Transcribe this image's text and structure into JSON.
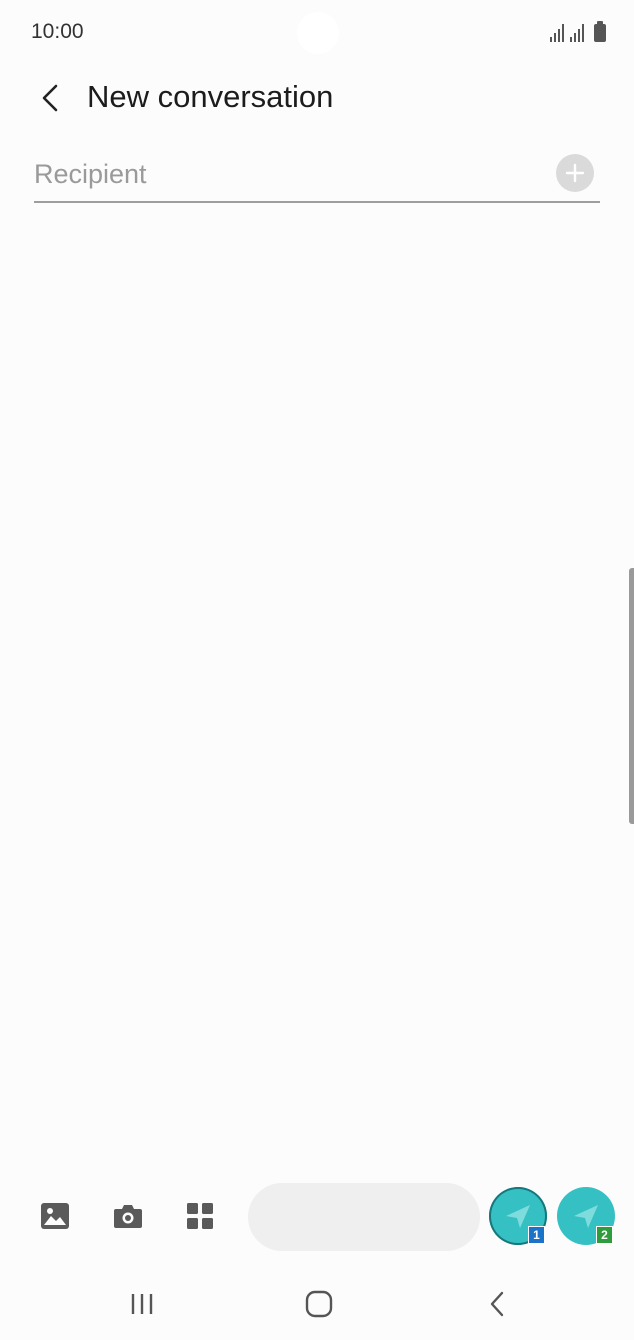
{
  "status_bar": {
    "time": "10:00",
    "icons": [
      "signal-icon",
      "signal-icon",
      "battery-icon"
    ]
  },
  "header": {
    "back_icon": "chevron-left-icon",
    "title": "New conversation"
  },
  "recipient": {
    "placeholder": "Recipient",
    "value": "",
    "add_icon": "plus-circle-icon"
  },
  "composer": {
    "icons": [
      "gallery-icon",
      "camera-icon",
      "apps-grid-icon"
    ],
    "message_value": "",
    "send_buttons": [
      {
        "icon": "send-icon",
        "sim_label": "1",
        "sim_color": "#1a73c9"
      },
      {
        "icon": "send-icon",
        "sim_label": "2",
        "sim_color": "#2e9b3c"
      }
    ]
  },
  "nav_bar": {
    "icons": [
      "recent-apps-icon",
      "home-icon",
      "back-icon"
    ]
  },
  "colors": {
    "accent": "#35c1c3",
    "background": "#fcfcfc",
    "input_background": "#efefef"
  }
}
